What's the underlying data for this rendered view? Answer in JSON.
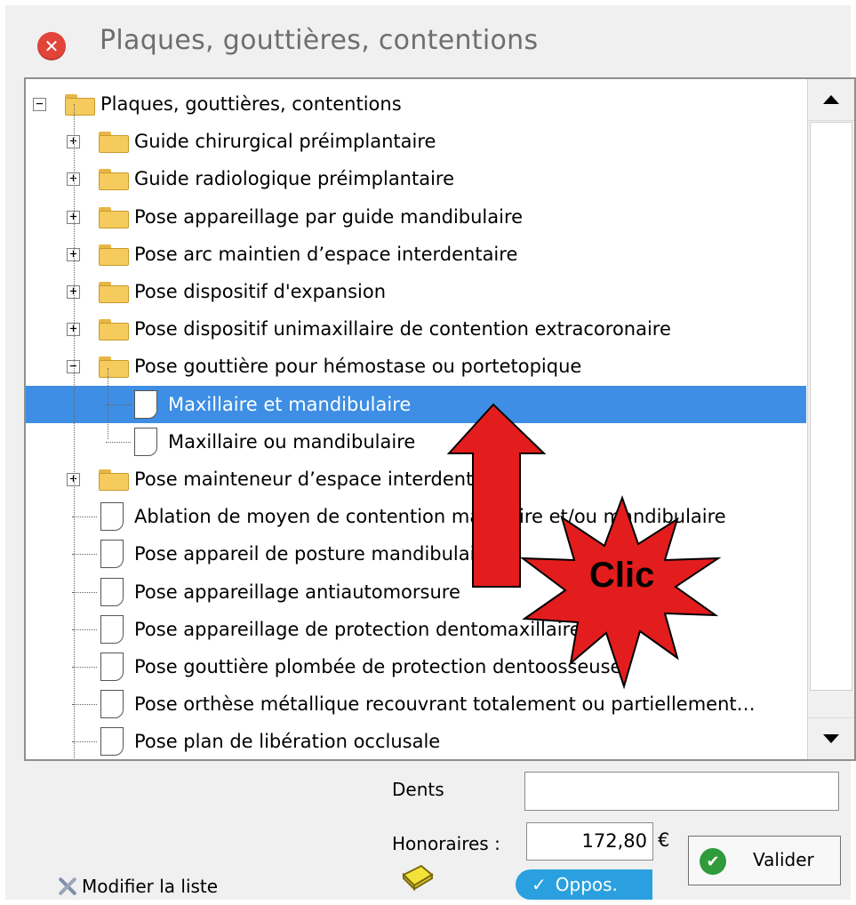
{
  "window": {
    "title": "Plaques, gouttières, contentions",
    "close_icon": "close-icon"
  },
  "tree": {
    "items": [
      {
        "label": "Plaques, gouttières, contentions",
        "type": "folder",
        "expanded": true,
        "level": 0
      },
      {
        "label": "Guide chirurgical préimplantaire",
        "type": "folder",
        "expanded": false,
        "level": 1
      },
      {
        "label": "Guide radiologique préimplantaire",
        "type": "folder",
        "expanded": false,
        "level": 1
      },
      {
        "label": "Pose appareillage par guide mandibulaire",
        "type": "folder",
        "expanded": false,
        "level": 1
      },
      {
        "label": "Pose arc maintien d’espace interdentaire",
        "type": "folder",
        "expanded": false,
        "level": 1
      },
      {
        "label": "Pose dispositif d'expansion",
        "type": "folder",
        "expanded": false,
        "level": 1
      },
      {
        "label": "Pose dispositif unimaxillaire de contention extracoronaire",
        "type": "folder",
        "expanded": false,
        "level": 1
      },
      {
        "label": "Pose gouttière pour hémostase ou portetopique",
        "type": "folder",
        "expanded": true,
        "level": 1
      },
      {
        "label": "Maxillaire et mandibulaire",
        "type": "doc",
        "selected": true,
        "level": 2
      },
      {
        "label": "Maxillaire ou mandibulaire",
        "type": "doc",
        "level": 2
      },
      {
        "label": "Pose mainteneur d’espace interdentaire",
        "type": "folder",
        "expanded": false,
        "level": 1
      },
      {
        "label": "Ablation de moyen de contention maxillaire et/ou mandibulaire",
        "type": "doc",
        "level": 1
      },
      {
        "label": "Pose appareil de posture mandibulaire",
        "type": "doc",
        "level": 1
      },
      {
        "label": "Pose appareillage antiautomorsure",
        "type": "doc",
        "level": 1
      },
      {
        "label": "Pose appareillage de protection dentomaxillaire",
        "type": "doc",
        "level": 1
      },
      {
        "label": "Pose gouttière plombée de protection dentoosseuse",
        "type": "doc",
        "level": 1
      },
      {
        "label": "Pose orthèse métallique recouvrant totalement ou partiellement…",
        "type": "doc",
        "level": 1
      },
      {
        "label": "Pose plan de libération occlusale",
        "type": "doc",
        "level": 1
      }
    ]
  },
  "form": {
    "dents_label": "Dents",
    "dents_value": "",
    "honoraires_label": "Honoraires :",
    "honoraires_value": "172,80",
    "currency": "€",
    "valider_label": "Valider",
    "modifier_label": "Modifier la liste",
    "oppos_label": "Oppos.",
    "oppos_check": "✓"
  },
  "annotation": {
    "text": "Clic",
    "arrow_color": "#e31d1d",
    "star_color": "#e31d1d"
  },
  "colors": {
    "selection": "#3d8ee4",
    "window_bg": "#f0f0f0",
    "oppos_bg": "#2aa0e0",
    "check_green": "#2f9b3a",
    "close_red": "#e2443a"
  }
}
